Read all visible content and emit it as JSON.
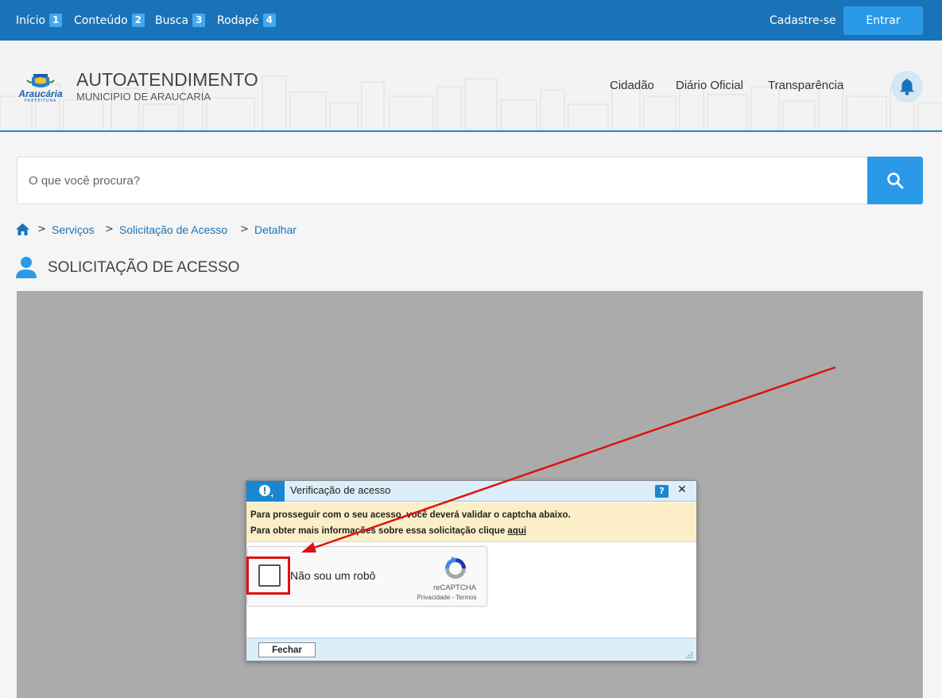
{
  "topbar": {
    "skip_links": [
      {
        "label": "Início",
        "num": "1"
      },
      {
        "label": "Conteúdo",
        "num": "2"
      },
      {
        "label": "Busca",
        "num": "3"
      },
      {
        "label": "Rodapé",
        "num": "4"
      }
    ],
    "register": "Cadastre-se",
    "login": "Entrar"
  },
  "header": {
    "logo_text": "Araucária",
    "logo_sub": "PREFEITURA",
    "title": "AUTOATENDIMENTO",
    "subtitle": "MUNICIPIO DE ARAUCARIA",
    "nav": [
      "Cidadão",
      "Diário Oficial",
      "Transparência"
    ]
  },
  "search": {
    "placeholder": "O que você procura?"
  },
  "breadcrumb": [
    "Serviços",
    "Solicitação de Acesso",
    "Detalhar"
  ],
  "page": {
    "title": "SOLICITAÇÃO DE ACESSO"
  },
  "modal": {
    "title": "Verificação de acesso",
    "help": "?",
    "close": "✕",
    "notice_line1": "Para prosseguir com o seu acesso, você deverá validar o captcha abaixo.",
    "notice_line2_prefix": "Para obter mais informações sobre essa solicitação clique ",
    "notice_link": "aqui",
    "captcha_label": "Não sou um robô",
    "captcha_brand": "reCAPTCHA",
    "captcha_links": "Privacidade - Termos",
    "close_button": "Fechar"
  },
  "colors": {
    "primary": "#1a73b8",
    "accent": "#2a9ae8",
    "annotation": "#e01010"
  }
}
